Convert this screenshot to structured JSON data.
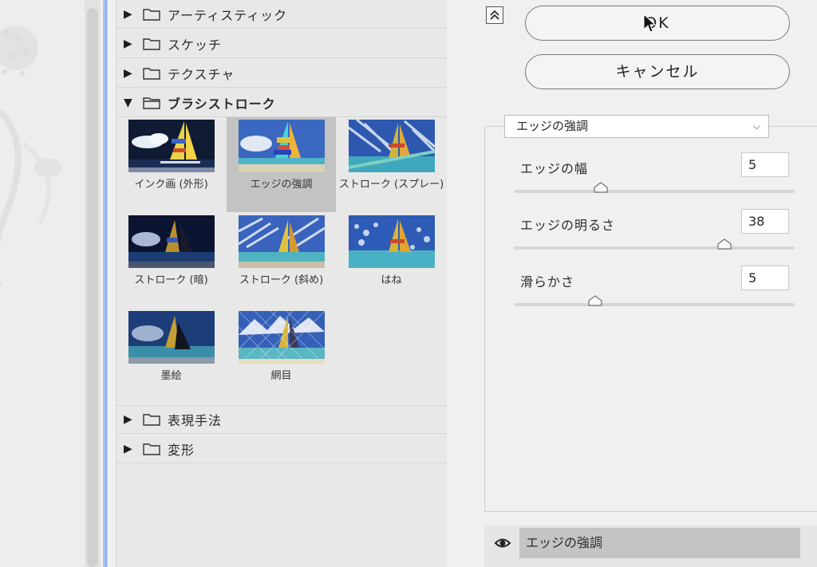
{
  "buttons": {
    "ok": "OK",
    "cancel": "キャンセル"
  },
  "categories": [
    {
      "label": "アーティスティック",
      "expanded": false
    },
    {
      "label": "スケッチ",
      "expanded": false
    },
    {
      "label": "テクスチャ",
      "expanded": false
    },
    {
      "label": "ブラシストローク",
      "expanded": true
    },
    {
      "label": "表現手法",
      "expanded": false
    },
    {
      "label": "変形",
      "expanded": false
    }
  ],
  "brush_filters": [
    {
      "name": "インク画 (外形)",
      "selected": false
    },
    {
      "name": "エッジの強調",
      "selected": true
    },
    {
      "name": "ストローク (スプレー)",
      "selected": false
    },
    {
      "name": "ストローク (暗)",
      "selected": false
    },
    {
      "name": "ストローク (斜め)",
      "selected": false
    },
    {
      "name": "はね",
      "selected": false
    },
    {
      "name": "墨絵",
      "selected": false
    },
    {
      "name": "網目",
      "selected": false
    }
  ],
  "settings": {
    "selected_filter": "エッジの強調",
    "params": [
      {
        "label": "エッジの幅",
        "value": "5",
        "slider_fraction": 0.31
      },
      {
        "label": "エッジの明るさ",
        "value": "38",
        "slider_fraction": 0.75
      },
      {
        "label": "滑らかさ",
        "value": "5",
        "slider_fraction": 0.29
      }
    ]
  },
  "layer": {
    "name": "エッジの強調",
    "visible": true
  },
  "colors": {
    "selection": "#c3c3c3",
    "divider_accent": "#a9c7f2"
  }
}
